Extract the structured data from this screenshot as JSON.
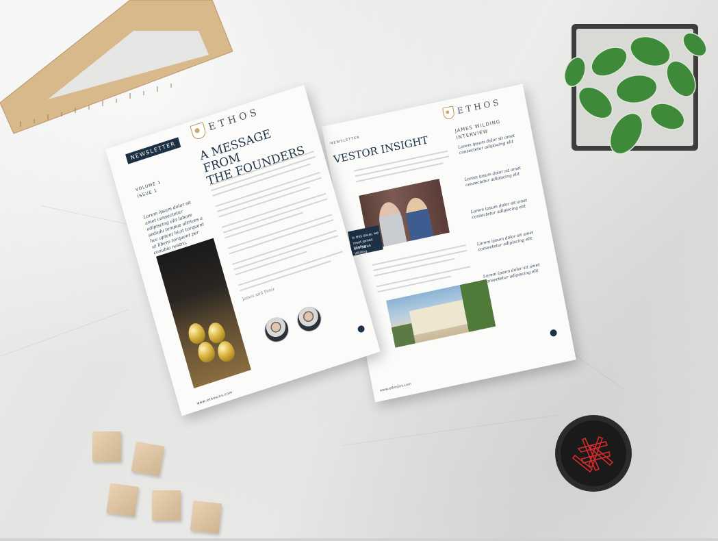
{
  "scene": {
    "description_free": true
  },
  "left_page": {
    "tag": "NEWSLETTER",
    "brand": "ETHOS",
    "headline_line1": "A MESSAGE FROM",
    "headline_line2": "THE FOUNDERS",
    "volume": "VOLUME 1",
    "issue": "ISSUE 1",
    "intro": "Lorem ipsum dolor sit amet consectetur adipiscing elit labore sedadu tempus ultrices a hac aptent hicit torquent ut libero torquent per conubia nostra.",
    "signature": "James and Peter",
    "footer_site": "www.ethosinv.com"
  },
  "right_page": {
    "brand": "ETHOS",
    "section_tag": "NEWSLETTER",
    "headline": "VESTOR INSIGHT",
    "column_title": "JAMES WILDING INTERVIEW",
    "column_items": [
      "Lorem ipsum dolor sit amet consectetur adipiscing elit",
      "Lorem ipsum dolor sit amet consectetur adipiscing elit",
      "Lorem ipsum dolor sit amet consectetur adipiscing elit",
      "Lorem ipsum dolor sit amet consectetur adipiscing elit",
      "Lorem ipsum dolor sit amet consectetur adipiscing elit"
    ],
    "caption_line1": "In this issue, we",
    "caption_line2": "meet James Wilding",
    "caption_line3": "and Sarah Wilding",
    "footer_site": "www.ethosinv.com"
  },
  "colors": {
    "navy": "#1d3145",
    "gold": "#b7955a",
    "marble": "#e6e6e4"
  }
}
